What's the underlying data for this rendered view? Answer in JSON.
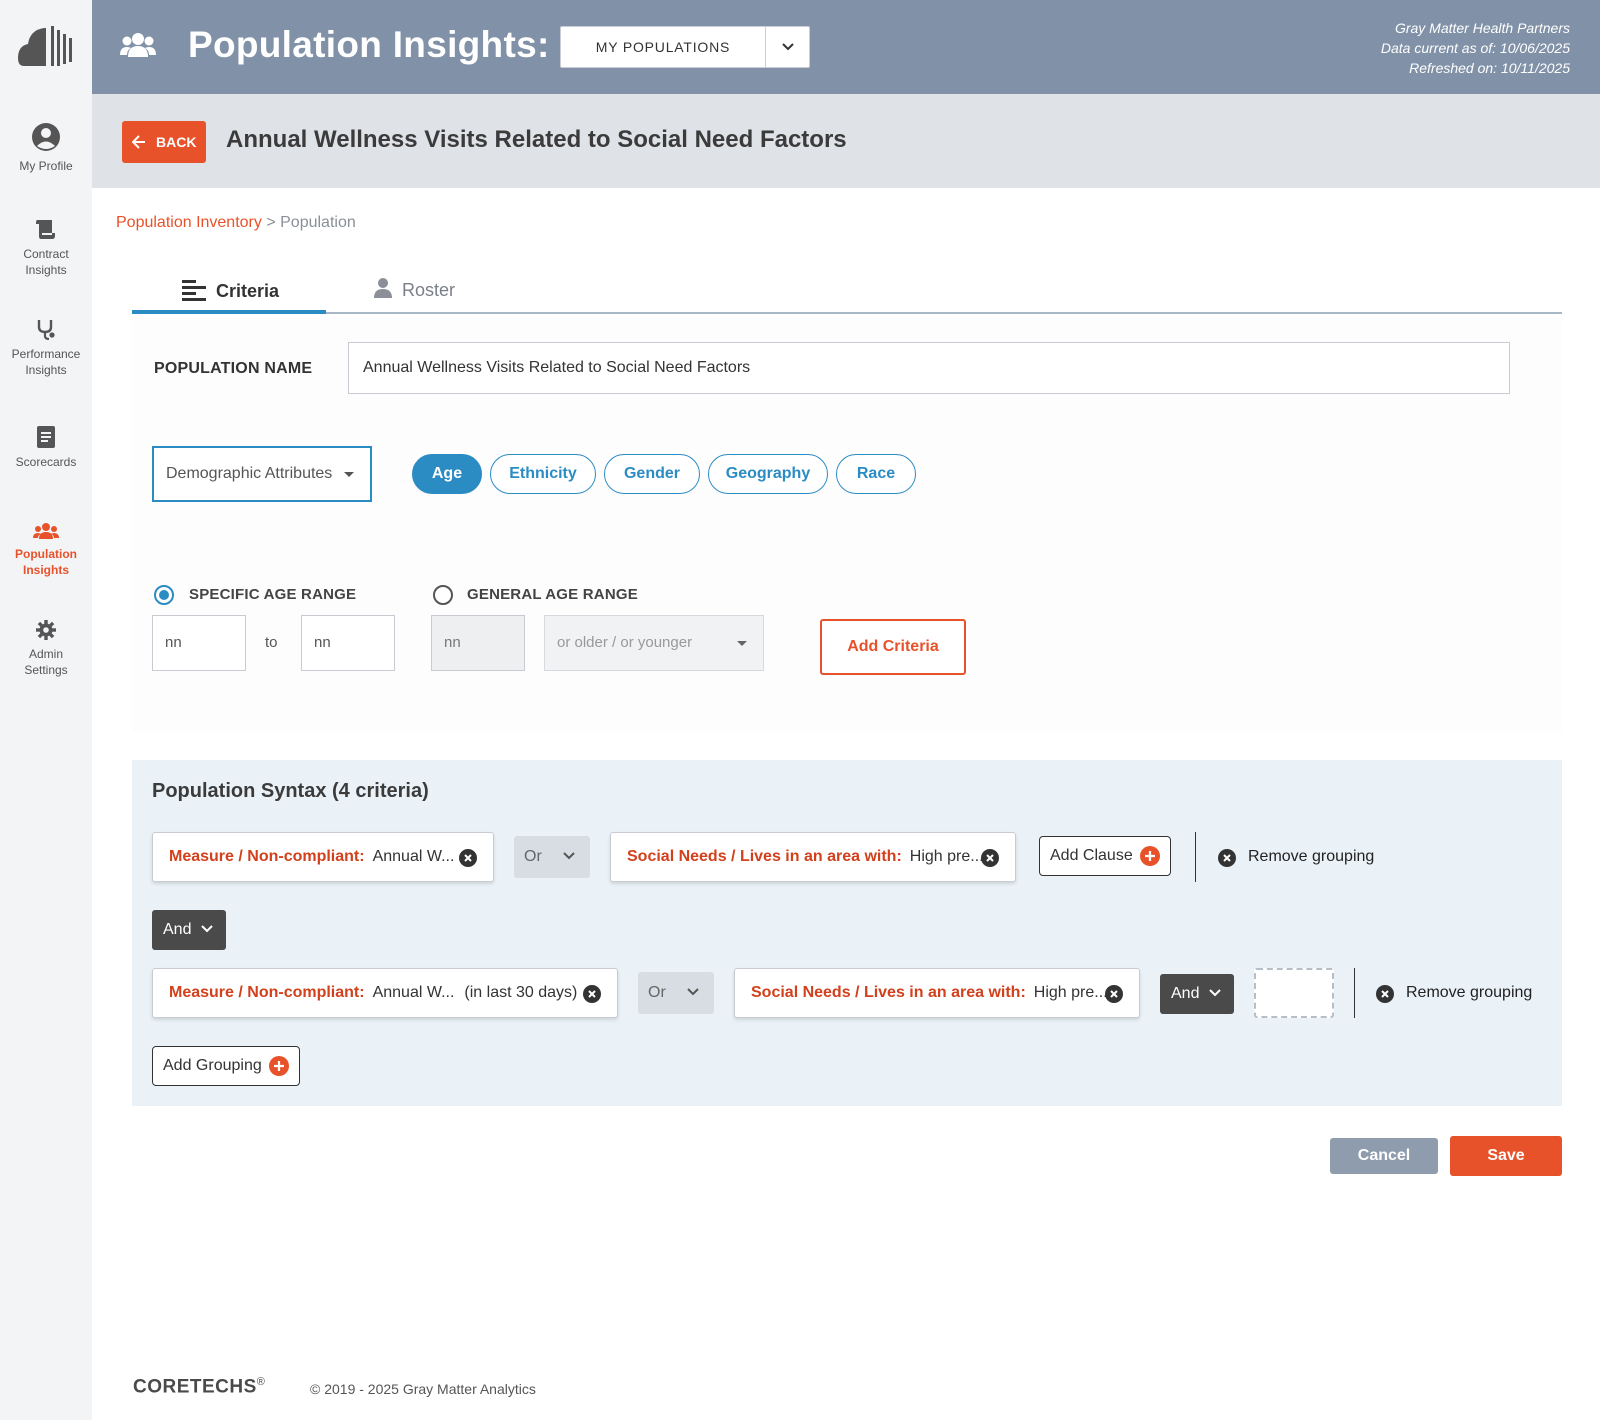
{
  "sidebar": {
    "items": [
      {
        "label": "My Profile"
      },
      {
        "label": "Contract Insights"
      },
      {
        "label": "Performance Insights"
      },
      {
        "label": "Scorecards"
      },
      {
        "label": "Population Insights",
        "active": true
      },
      {
        "label": "Admin Settings"
      }
    ]
  },
  "header": {
    "title": "Population Insights:",
    "populations_select": "MY POPULATIONS",
    "org": "Gray Matter Health Partners",
    "data_current": "Data current as of: 10/06/2025",
    "refreshed": "Refreshed on: 10/11/2025"
  },
  "titlebar": {
    "back_label": "BACK",
    "page_title": "Annual Wellness Visits Related to Social Need Factors"
  },
  "breadcrumb": {
    "link": "Population Inventory",
    "separator": ">",
    "current": "Population"
  },
  "tabs": [
    {
      "label": "Criteria",
      "active": true
    },
    {
      "label": "Roster"
    }
  ],
  "criteria": {
    "population_name_label": "POPULATION NAME",
    "population_name_value": "Annual Wellness Visits Related to Social Need Factors",
    "category_select": "Demographic  Attributes",
    "pills": [
      "Age",
      "Ethnicity",
      "Gender",
      "Geography",
      "Race"
    ],
    "active_pill": "Age",
    "specific_age_label": "SPECIFIC AGE RANGE",
    "general_age_label": "GENERAL AGE RANGE",
    "from_placeholder": "nn",
    "to_label": "to",
    "to_placeholder": "nn",
    "general_placeholder": "nn",
    "older_younger_select": "or older / or younger",
    "add_criteria_label": "Add Criteria"
  },
  "syntax": {
    "title": "Population Syntax (4 criteria)",
    "group1": {
      "chip1_key": "Measure / Non-compliant:",
      "chip1_value": "Annual W...",
      "operator": "Or",
      "chip2_key": "Social Needs / Lives in an area with:",
      "chip2_value": "High pre...",
      "add_clause": "Add Clause",
      "remove_grouping": "Remove grouping"
    },
    "group_operator": "And",
    "group2": {
      "chip1_key": "Measure / Non-compliant:",
      "chip1_value": "Annual W...",
      "chip1_extra": "(in last 30 days)",
      "operator": "Or",
      "chip2_key": "Social Needs / Lives in an area with:",
      "chip2_value": "High pre...",
      "clause_operator": "And",
      "remove_grouping": "Remove grouping"
    },
    "add_grouping": "Add Grouping"
  },
  "actions": {
    "cancel": "Cancel",
    "save": "Save"
  },
  "footer": {
    "brand": "CORETECHS",
    "brand_mark": "®",
    "copyright": "© 2019 - 2025 Gray Matter Analytics"
  },
  "colors": {
    "accent": "#e8522a",
    "primary_blue": "#2b8cc4",
    "header_bg": "#8192a8",
    "syntax_bg": "#eaf2f8"
  }
}
